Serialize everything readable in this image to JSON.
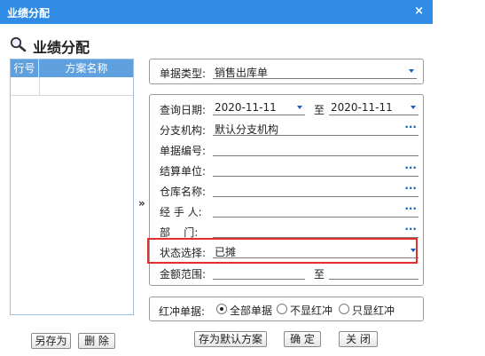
{
  "window": {
    "title": "业绩分配",
    "close_glyph": "×"
  },
  "heading": {
    "text": "业绩分配",
    "icon": "magnifier-icon"
  },
  "grid": {
    "columns": [
      "行号",
      "方案名称"
    ]
  },
  "splitter": {
    "glyph": "»"
  },
  "doc_type": {
    "label": "单据类型:",
    "value": "销售出库单"
  },
  "query_date": {
    "label": "查询日期:",
    "from": "2020-11-11",
    "to_label": "至",
    "to": "2020-11-11"
  },
  "branch": {
    "label": "分支机构:",
    "value": "默认分支机构"
  },
  "doc_no": {
    "label": "单据编号:",
    "value": ""
  },
  "settlement": {
    "label": "结算单位:",
    "value": ""
  },
  "warehouse": {
    "label": "仓库名称:",
    "value": ""
  },
  "handler": {
    "label": "经 手 人:",
    "value": ""
  },
  "department": {
    "label": "部    门:",
    "value": ""
  },
  "status": {
    "label": "状态选择:",
    "value": "已摊"
  },
  "amount": {
    "label": "金额范围:",
    "from": "",
    "to_label": "至",
    "to": ""
  },
  "red_flush": {
    "label": "红冲单据:",
    "options": [
      "全部单据",
      "不显红冲",
      "只显红冲"
    ],
    "selected_index": 0
  },
  "buttons": {
    "save_as": "另存为",
    "delete": "删 除",
    "save_default": "存为默认方案",
    "ok": "确 定",
    "close": "关 闭"
  },
  "colors": {
    "title_bar": "#2f8be3",
    "grid_header": "#5fa0de",
    "highlight": "#e0302f",
    "accent": "#1a5fb4"
  }
}
